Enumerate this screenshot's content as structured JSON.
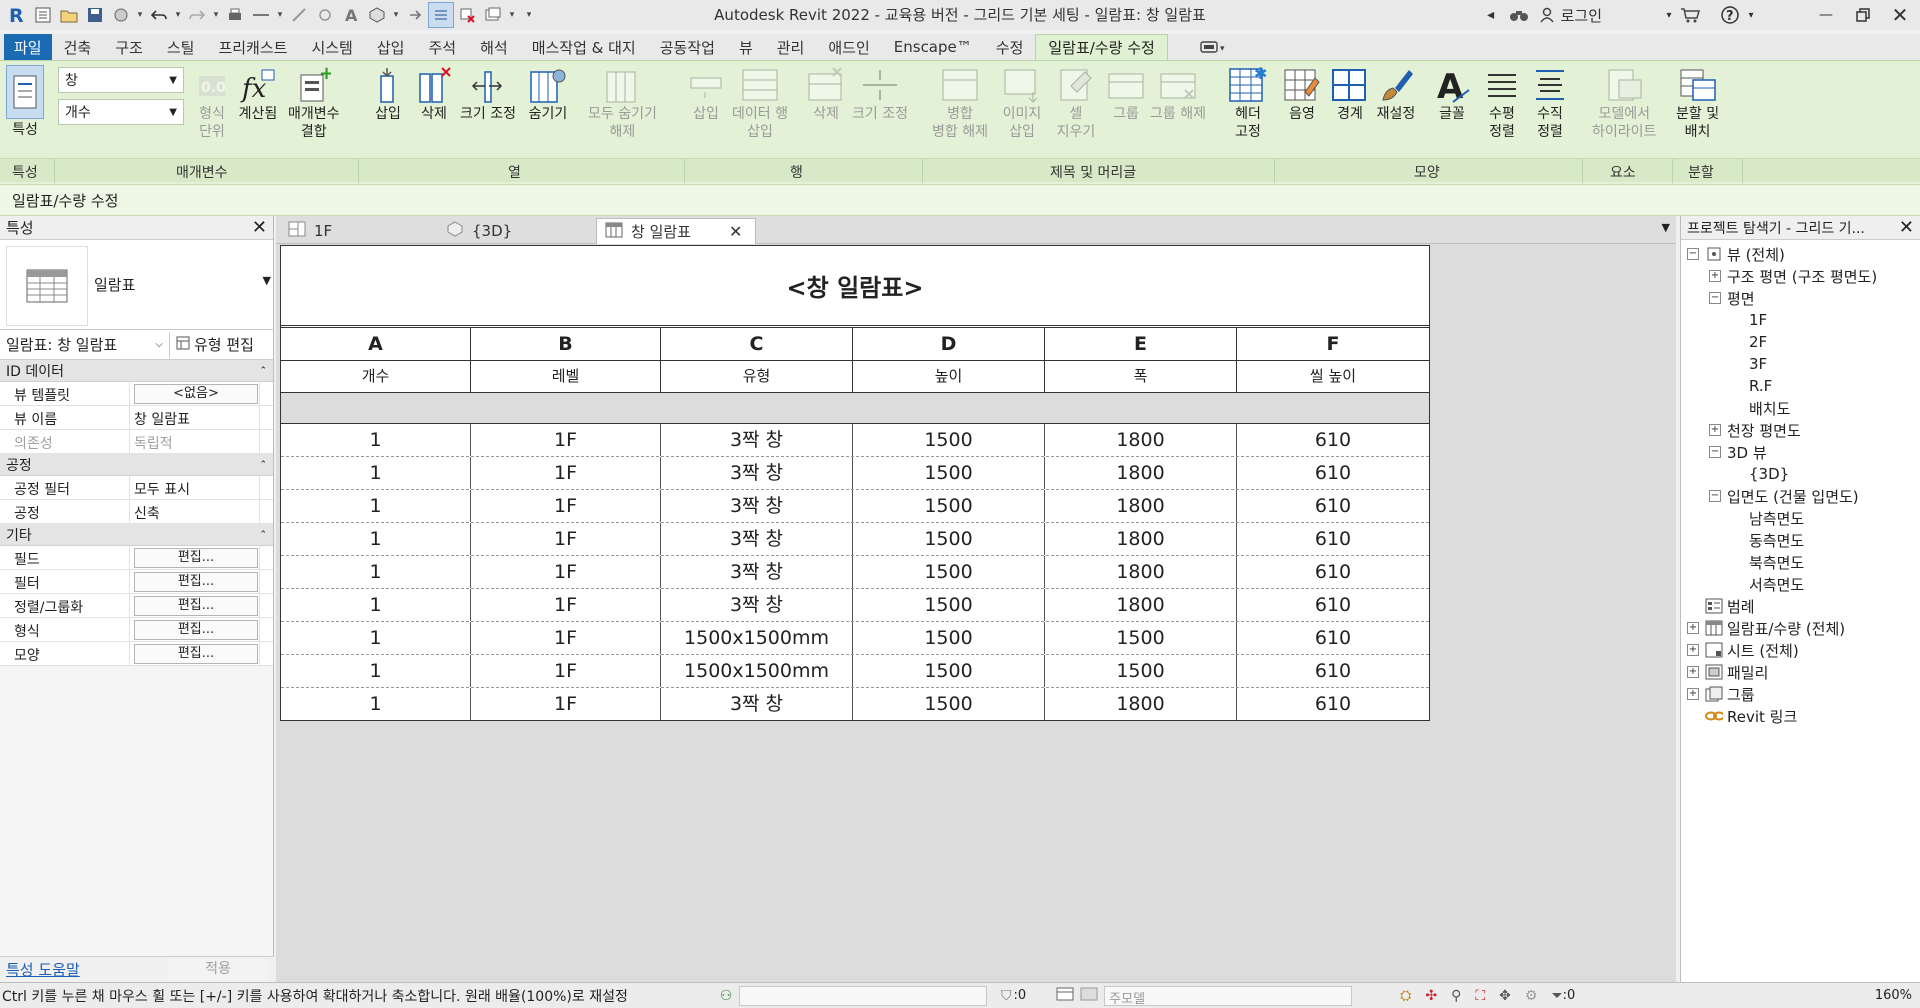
{
  "window": {
    "title": "Autodesk Revit 2022 - 교육용 버전 - 그리드 기본 세팅 - 일람표: 창 일람표",
    "login_label": "로그인"
  },
  "ribbon_tabs": [
    "파일",
    "건축",
    "구조",
    "스틸",
    "프리캐스트",
    "시스템",
    "삽입",
    "주석",
    "해석",
    "매스작업 & 대지",
    "공동작업",
    "뷰",
    "관리",
    "애드인",
    "Enscape™",
    "수정",
    "일람표/수량 수정"
  ],
  "ribbon": {
    "properties_label": "특성",
    "param_select_1": "창",
    "param_select_2": "개수",
    "tools": {
      "format_unit": "형식\n단위",
      "calculated": "계산됨",
      "combine_params": "매개변수\n결합",
      "col_insert": "삽입",
      "col_delete": "삭제",
      "col_resize": "크기 조정",
      "col_hide": "숨기기",
      "col_unhide_all": "모두 숨기기\n해제",
      "row_insert": "삽입",
      "row_insert_data": "데이터 행\n삽입",
      "row_delete": "삭제",
      "row_resize": "크기 조정",
      "merge_unmerge": "병합\n병합 해제",
      "insert_image": "이미지\n삽입",
      "clear_cell": "셀\n지우기",
      "group": "그룹",
      "ungroup": "그룹 해제",
      "freeze_header": "헤더\n고정",
      "shading": "음영",
      "borders": "경계",
      "reset": "재설정",
      "font": "글꼴",
      "align_h": "수평\n정렬",
      "align_v": "수직\n정렬",
      "highlight_in_model": "모델에서\n하이라이트",
      "split_place": "분할 및\n배치"
    },
    "panels": [
      "특성",
      "매개변수",
      "열",
      "행",
      "제목 및 머리글",
      "모양",
      "요소",
      "분할"
    ]
  },
  "context_bar": "일람표/수량 수정",
  "properties": {
    "title": "특성",
    "type_name": "일람표",
    "instance_selector": "일람표: 창 일람표",
    "edit_type": "유형 편집",
    "groups": [
      {
        "name": "ID 데이터",
        "rows": [
          {
            "k": "뷰 템플릿",
            "v": "<없음>",
            "button": true,
            "disabled": false
          },
          {
            "k": "뷰 이름",
            "v": "창 일람표",
            "button": false,
            "disabled": false
          },
          {
            "k": "의존성",
            "v": "독립적",
            "button": false,
            "disabled": true
          }
        ]
      },
      {
        "name": "공정",
        "rows": [
          {
            "k": "공정 필터",
            "v": "모두 표시",
            "button": false,
            "disabled": false
          },
          {
            "k": "공정",
            "v": "신축",
            "button": false,
            "disabled": false
          }
        ]
      },
      {
        "name": "기타",
        "rows": [
          {
            "k": "필드",
            "v": "편집...",
            "button": true,
            "disabled": false
          },
          {
            "k": "필터",
            "v": "편집...",
            "button": true,
            "disabled": false
          },
          {
            "k": "정렬/그룹화",
            "v": "편집...",
            "button": true,
            "disabled": false
          },
          {
            "k": "형식",
            "v": "편집...",
            "button": true,
            "disabled": false
          },
          {
            "k": "모양",
            "v": "편집...",
            "button": true,
            "disabled": false
          }
        ]
      }
    ],
    "help_link": "특성 도움말",
    "apply": "적용"
  },
  "view_tabs": [
    {
      "label": "1F",
      "icon": "floor-plan-icon",
      "active": false
    },
    {
      "label": "{3D}",
      "icon": "3d-view-icon",
      "active": false
    },
    {
      "label": "창 일람표",
      "icon": "schedule-icon",
      "active": true
    }
  ],
  "schedule": {
    "title": "<창 일람표>",
    "letters": [
      "A",
      "B",
      "C",
      "D",
      "E",
      "F"
    ],
    "headers": [
      "개수",
      "레벨",
      "유형",
      "높이",
      "폭",
      "씰 높이"
    ],
    "rows": [
      [
        "1",
        "1F",
        "3짝 창",
        "1500",
        "1800",
        "610"
      ],
      [
        "1",
        "1F",
        "3짝 창",
        "1500",
        "1800",
        "610"
      ],
      [
        "1",
        "1F",
        "3짝 창",
        "1500",
        "1800",
        "610"
      ],
      [
        "1",
        "1F",
        "3짝 창",
        "1500",
        "1800",
        "610"
      ],
      [
        "1",
        "1F",
        "3짝 창",
        "1500",
        "1800",
        "610"
      ],
      [
        "1",
        "1F",
        "3짝 창",
        "1500",
        "1800",
        "610"
      ],
      [
        "1",
        "1F",
        "1500x1500mm",
        "1500",
        "1500",
        "610"
      ],
      [
        "1",
        "1F",
        "1500x1500mm",
        "1500",
        "1500",
        "610"
      ],
      [
        "1",
        "1F",
        "3짝 창",
        "1500",
        "1800",
        "610"
      ]
    ]
  },
  "browser": {
    "title": "프로젝트 탐색기 - 그리드 기...",
    "nodes": [
      {
        "label": "뷰 (전체)",
        "level": 0,
        "exp": "−",
        "icon": "views-icon"
      },
      {
        "label": "구조 평면 (구조 평면도)",
        "level": 1,
        "exp": "+",
        "icon": ""
      },
      {
        "label": "평면",
        "level": 1,
        "exp": "−",
        "icon": ""
      },
      {
        "label": "1F",
        "level": 2,
        "exp": "",
        "icon": ""
      },
      {
        "label": "2F",
        "level": 2,
        "exp": "",
        "icon": ""
      },
      {
        "label": "3F",
        "level": 2,
        "exp": "",
        "icon": ""
      },
      {
        "label": "R.F",
        "level": 2,
        "exp": "",
        "icon": ""
      },
      {
        "label": "배치도",
        "level": 2,
        "exp": "",
        "icon": ""
      },
      {
        "label": "천장 평면도",
        "level": 1,
        "exp": "+",
        "icon": ""
      },
      {
        "label": "3D 뷰",
        "level": 1,
        "exp": "−",
        "icon": ""
      },
      {
        "label": "{3D}",
        "level": 2,
        "exp": "",
        "icon": ""
      },
      {
        "label": "입면도 (건물 입면도)",
        "level": 1,
        "exp": "−",
        "icon": ""
      },
      {
        "label": "남측면도",
        "level": 2,
        "exp": "",
        "icon": ""
      },
      {
        "label": "동측면도",
        "level": 2,
        "exp": "",
        "icon": ""
      },
      {
        "label": "북측면도",
        "level": 2,
        "exp": "",
        "icon": ""
      },
      {
        "label": "서측면도",
        "level": 2,
        "exp": "",
        "icon": ""
      },
      {
        "label": "범례",
        "level": 0,
        "exp": "",
        "icon": "legend-icon"
      },
      {
        "label": "일람표/수량 (전체)",
        "level": 0,
        "exp": "+",
        "icon": "schedules-icon"
      },
      {
        "label": "시트 (전체)",
        "level": 0,
        "exp": "+",
        "icon": "sheets-icon"
      },
      {
        "label": "패밀리",
        "level": 0,
        "exp": "+",
        "icon": "families-icon"
      },
      {
        "label": "그룹",
        "level": 0,
        "exp": "+",
        "icon": "groups-icon"
      },
      {
        "label": "Revit 링크",
        "level": 0,
        "exp": "",
        "icon": "revit-links-icon"
      }
    ]
  },
  "status": {
    "message": "Ctrl 키를 누른 채 마우스 휠 또는 [+/-] 키를 사용하여 확대하거나 축소합니다. 원래 배율(100%)로 재설정",
    "filter_count": ":0",
    "model_select": "주모델",
    "zoom": "160%"
  },
  "colors": {
    "ribbon_bg": "#e3f1d6",
    "file_tab": "#1b6ab4",
    "link": "#1a5fb4"
  }
}
